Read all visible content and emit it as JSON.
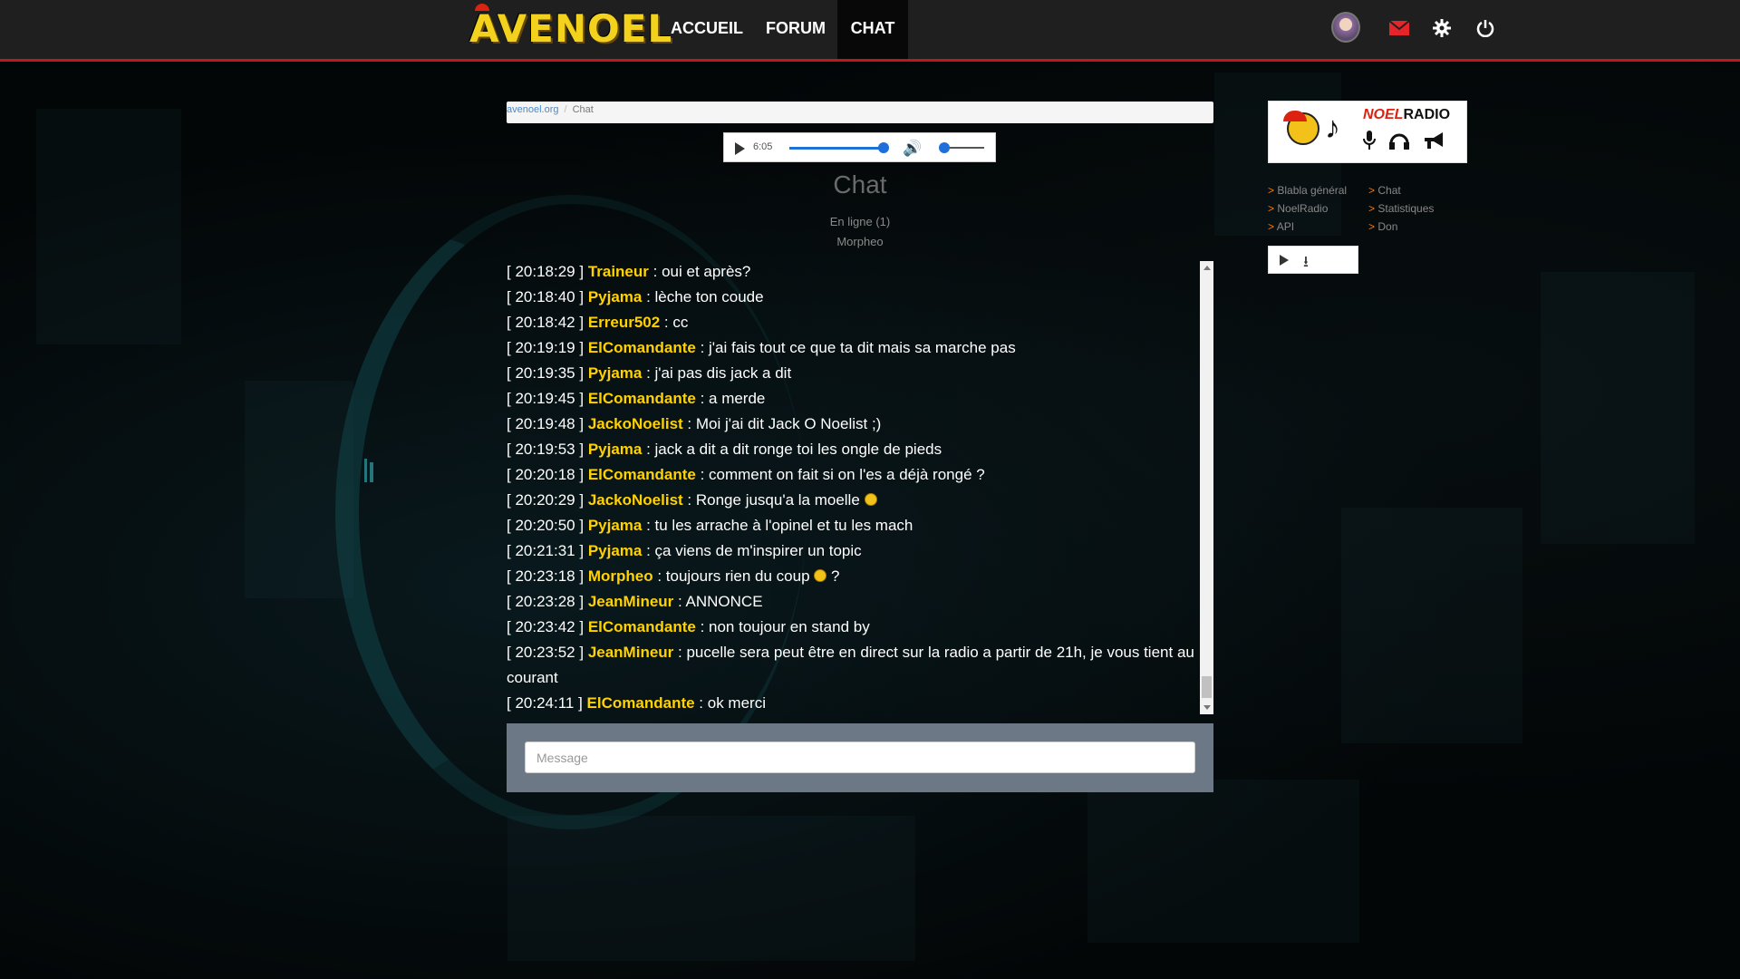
{
  "nav": {
    "logo_text": "AVENOEL",
    "items": [
      {
        "label": "ACCUEIL",
        "active": false
      },
      {
        "label": "FORUM",
        "active": false
      },
      {
        "label": "CHAT",
        "active": true
      }
    ],
    "icons": [
      "avatar",
      "mail-icon",
      "gear-icon",
      "power-icon"
    ],
    "accent_color": "#c01818"
  },
  "breadcrumb": {
    "home": "avenoel.org",
    "current": "Chat"
  },
  "player": {
    "time": "6:05",
    "progress": 0.92,
    "volume": 0.0
  },
  "chat": {
    "title": "Chat",
    "online_label": "En ligne (1)",
    "online_users": "Morpheo",
    "messages": [
      {
        "time": "[ 20:18:29 ]",
        "user": "Traineur",
        "text": " : oui et après?"
      },
      {
        "time": "[ 20:18:40 ]",
        "user": "Pyjama",
        "text": " : lèche ton coude"
      },
      {
        "time": "[ 20:18:42 ]",
        "user": "Erreur502",
        "text": " : cc"
      },
      {
        "time": "[ 20:19:19 ]",
        "user": "ElComandante",
        "text": " : j'ai fais tout ce que ta dit mais sa marche pas"
      },
      {
        "time": "[ 20:19:35 ]",
        "user": "Pyjama",
        "text": " : j'ai pas dis jack a dit"
      },
      {
        "time": "[ 20:19:45 ]",
        "user": "ElComandante",
        "text": " : a merde"
      },
      {
        "time": "[ 20:19:48 ]",
        "user": "JackoNoelist",
        "text": " : Moi j'ai dit Jack O Noelist ;)"
      },
      {
        "time": "[ 20:19:53 ]",
        "user": "Pyjama",
        "text": " : jack a dit a dit ronge toi les ongle de pieds"
      },
      {
        "time": "[ 20:20:18 ]",
        "user": "ElComandante",
        "text": " : comment on fait si on l'es a déjà rongé ?"
      },
      {
        "time": "[ 20:20:29 ]",
        "user": "JackoNoelist",
        "text": " : Ronge jusqu'a la moelle",
        "emoji": true
      },
      {
        "time": "[ 20:20:50 ]",
        "user": "Pyjama",
        "text": " : tu les arrache à l'opinel et tu les mach"
      },
      {
        "time": "[ 20:21:31 ]",
        "user": "Pyjama",
        "text": " : ça viens de m'inspirer un topic"
      },
      {
        "time": "[ 20:23:18 ]",
        "user": "Morpheo",
        "text": " : toujours rien du coup",
        "emoji": true,
        "after": " ?"
      },
      {
        "time": "[ 20:23:28 ]",
        "user": "JeanMineur",
        "text": " : ANNONCE"
      },
      {
        "time": "[ 20:23:42 ]",
        "user": "ElComandante",
        "text": " : non toujour en stand by"
      },
      {
        "time": "[ 20:23:52 ]",
        "user": "JeanMineur",
        "text": " : pucelle sera peut être en direct sur la radio a partir de 21h, je vous tient au courant"
      },
      {
        "time": "[ 20:24:11 ]",
        "user": "ElComandante",
        "text": " : ok merci"
      }
    ],
    "user_color": "#ffd200",
    "input_placeholder": "Message"
  },
  "sidebar": {
    "radio": {
      "name_part1": "NOEL",
      "name_part2": "RADIO"
    },
    "links_col1": [
      "Blabla général",
      "NoelRadio",
      "API"
    ],
    "links_col2": [
      "Chat",
      "Statistiques",
      "Don"
    ],
    "link_prefix": ">"
  }
}
